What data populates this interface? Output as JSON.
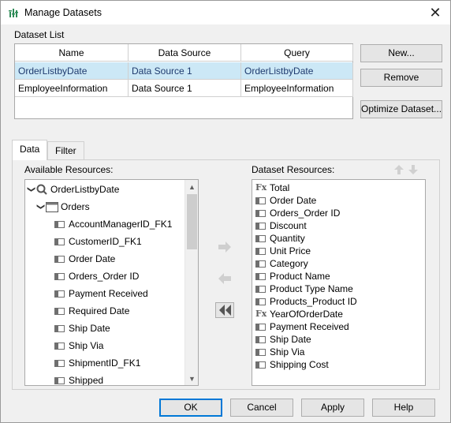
{
  "window": {
    "title": "Manage Datasets"
  },
  "dataset_list": {
    "label": "Dataset List",
    "columns": [
      "Name",
      "Data Source",
      "Query"
    ],
    "rows": [
      [
        "OrderListbyDate",
        "Data Source 1",
        "OrderListbyDate"
      ],
      [
        "EmployeeInformation",
        "Data Source 1",
        "EmployeeInformation"
      ]
    ],
    "selected_row": 0
  },
  "side_buttons": {
    "new": "New...",
    "remove": "Remove",
    "optimize": "Optimize Dataset..."
  },
  "tabs": [
    "Data",
    "Filter"
  ],
  "available": {
    "label": "Available Resources:",
    "query": "OrderListbyDate",
    "table": "Orders",
    "columns": [
      "AccountManagerID_FK1",
      "CustomerID_FK1",
      "Order Date",
      "Orders_Order ID",
      "Payment Received",
      "Required Date",
      "Ship Date",
      "Ship Via",
      "ShipmentID_FK1",
      "Shipped"
    ]
  },
  "dataset_resources": {
    "label": "Dataset Resources:",
    "items": [
      {
        "name": "Total",
        "type": "formula"
      },
      {
        "name": "Order Date",
        "type": "column"
      },
      {
        "name": "Orders_Order ID",
        "type": "column"
      },
      {
        "name": "Discount",
        "type": "column"
      },
      {
        "name": "Quantity",
        "type": "column"
      },
      {
        "name": "Unit Price",
        "type": "column"
      },
      {
        "name": "Category",
        "type": "column"
      },
      {
        "name": "Product Name",
        "type": "column"
      },
      {
        "name": "Product Type Name",
        "type": "column"
      },
      {
        "name": "Products_Product ID",
        "type": "column"
      },
      {
        "name": "YearOfOrderDate",
        "type": "formula"
      },
      {
        "name": "Payment Received",
        "type": "column"
      },
      {
        "name": "Ship Date",
        "type": "column"
      },
      {
        "name": "Ship Via",
        "type": "column"
      },
      {
        "name": "Shipping Cost",
        "type": "column"
      }
    ]
  },
  "footer": {
    "ok": "OK",
    "cancel": "Cancel",
    "apply": "Apply",
    "help": "Help"
  },
  "icons": {
    "formula": "Fx"
  }
}
